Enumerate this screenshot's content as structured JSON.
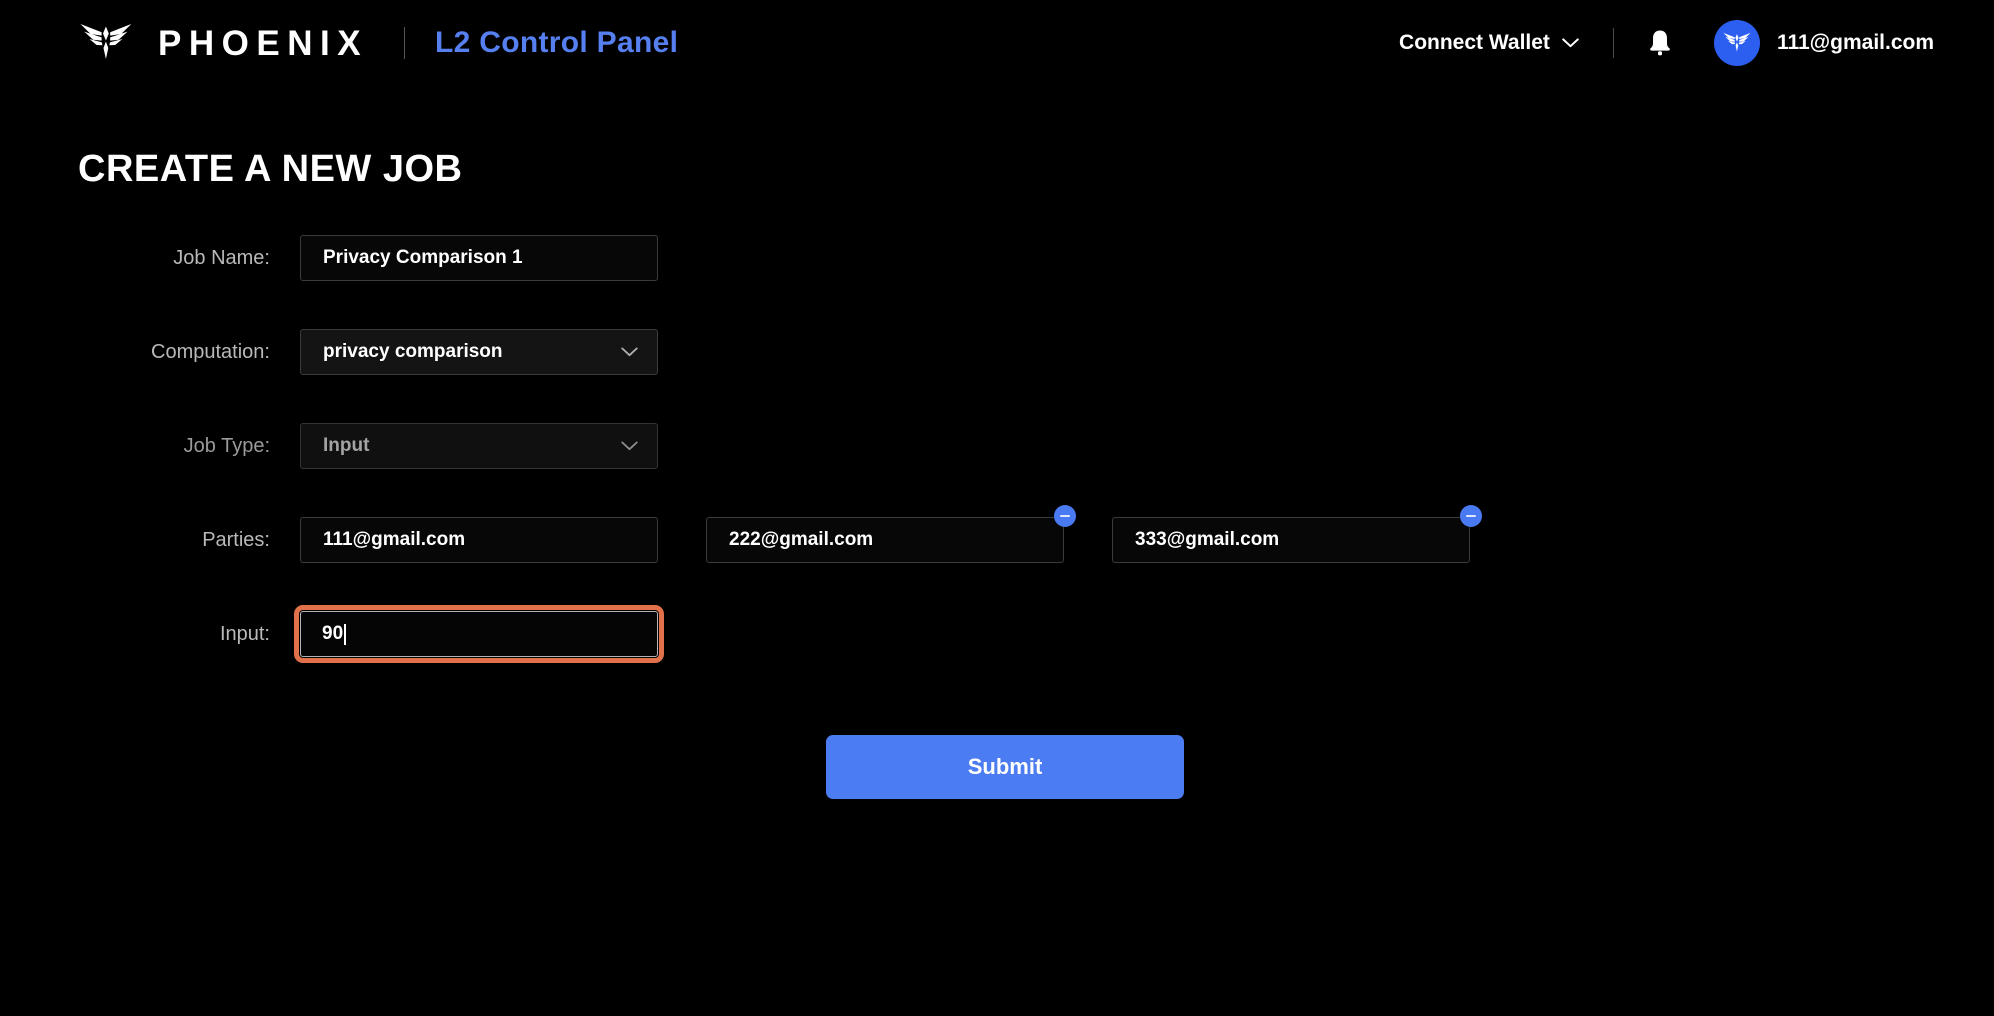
{
  "header": {
    "brand_name": "PHOENIX",
    "brand_logo_icon": "phoenix-logo-icon",
    "app_title": "L2 Control Panel",
    "wallet_label": "Connect Wallet",
    "wallet_chevron_icon": "chevron-down-icon",
    "notifications_icon": "bell-icon",
    "avatar_icon": "phoenix-avatar-icon",
    "account_email": "111@gmail.com"
  },
  "main": {
    "page_title": "CREATE A NEW JOB",
    "fields": {
      "job_name": {
        "label": "Job Name:",
        "value": "Privacy Comparison 1",
        "placeholder": "Job Name"
      },
      "computation": {
        "label": "Computation:",
        "value": "privacy comparison",
        "chevron_icon": "chevron-down-icon"
      },
      "job_type": {
        "label": "Job Type:",
        "value": "Input",
        "chevron_icon": "chevron-down-icon"
      },
      "parties": {
        "label": "Parties:",
        "values": [
          "111@gmail.com",
          "222@gmail.com",
          "333@gmail.com"
        ],
        "remove_icon": "minus-circle-icon"
      },
      "input": {
        "label": "Input:",
        "value": "90",
        "focused": true
      }
    },
    "submit_label": "Submit"
  },
  "colors": {
    "background": "#000000",
    "accent_blue": "#4c7cf1",
    "title_blue": "#5680f0",
    "focus_orange": "#e0714a",
    "label_gray": "#b9b9b9",
    "field_border": "#3b3b3b"
  }
}
